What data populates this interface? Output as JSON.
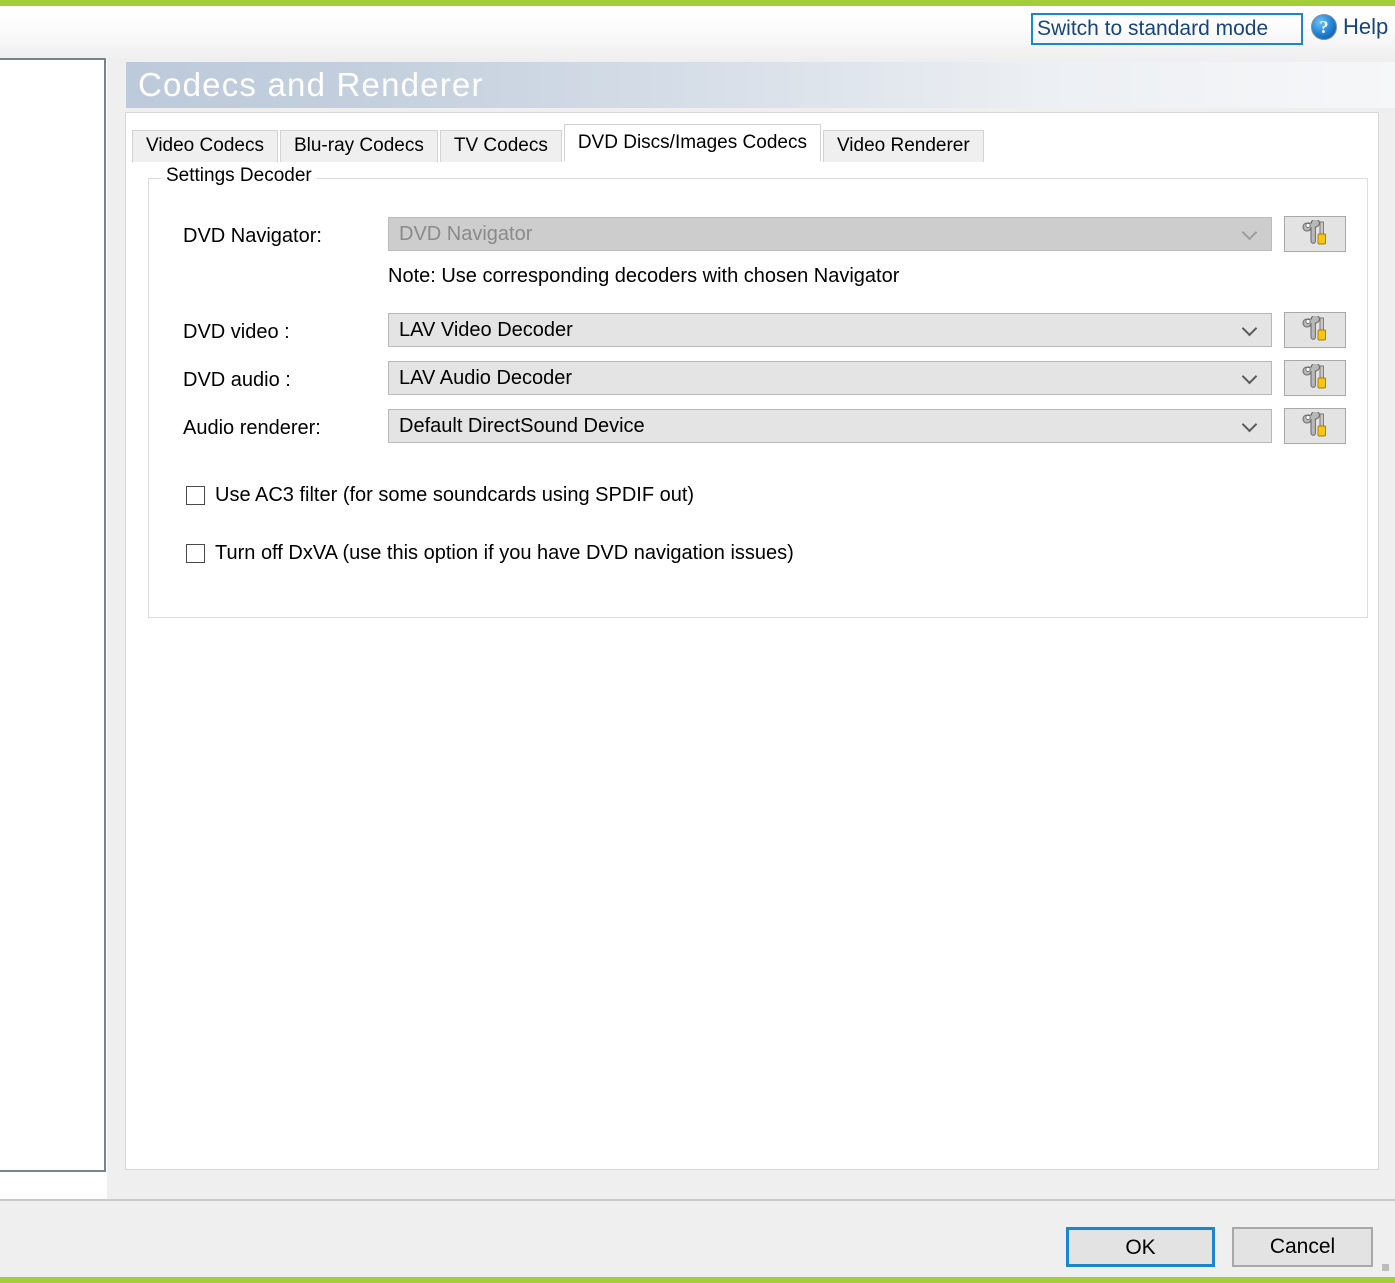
{
  "window": {
    "title": "Codecs and Renderer"
  },
  "topbar": {
    "switch_mode_label": "Switch to standard mode",
    "help_label": "Help",
    "help_icon": "question-circle-icon"
  },
  "tabs": [
    {
      "label": "Video Codecs",
      "active": false
    },
    {
      "label": "Blu-ray Codecs",
      "active": false
    },
    {
      "label": "TV Codecs",
      "active": false
    },
    {
      "label": "DVD Discs/Images Codecs",
      "active": true
    },
    {
      "label": "Video Renderer",
      "active": false
    }
  ],
  "group": {
    "legend": "Settings Decoder",
    "note": "Note: Use corresponding decoders with chosen Navigator",
    "settings_icon": "wrench-screwdriver-icon",
    "rows": [
      {
        "label": "DVD Navigator:",
        "value": "DVD Navigator",
        "disabled": true
      },
      {
        "label": "DVD video :",
        "value": "LAV Video Decoder",
        "disabled": false
      },
      {
        "label": "DVD audio :",
        "value": "LAV Audio Decoder",
        "disabled": false
      },
      {
        "label": "Audio renderer:",
        "value": "Default DirectSound Device",
        "disabled": false
      }
    ],
    "checkboxes": [
      {
        "label": "Use AC3 filter (for some soundcards using SPDIF out)",
        "checked": false
      },
      {
        "label": "Turn off DxVA (use this option if you have DVD navigation issues)",
        "checked": false
      }
    ]
  },
  "footer": {
    "ok_label": "OK",
    "cancel_label": "Cancel"
  },
  "colors": {
    "accent_green": "#a4ce39",
    "focus_blue": "#1a86d0",
    "link_blue": "#16457e",
    "panel_gray": "#efefef",
    "control_gray": "#e4e4e4",
    "disabled_gray": "#cdcdcd"
  }
}
